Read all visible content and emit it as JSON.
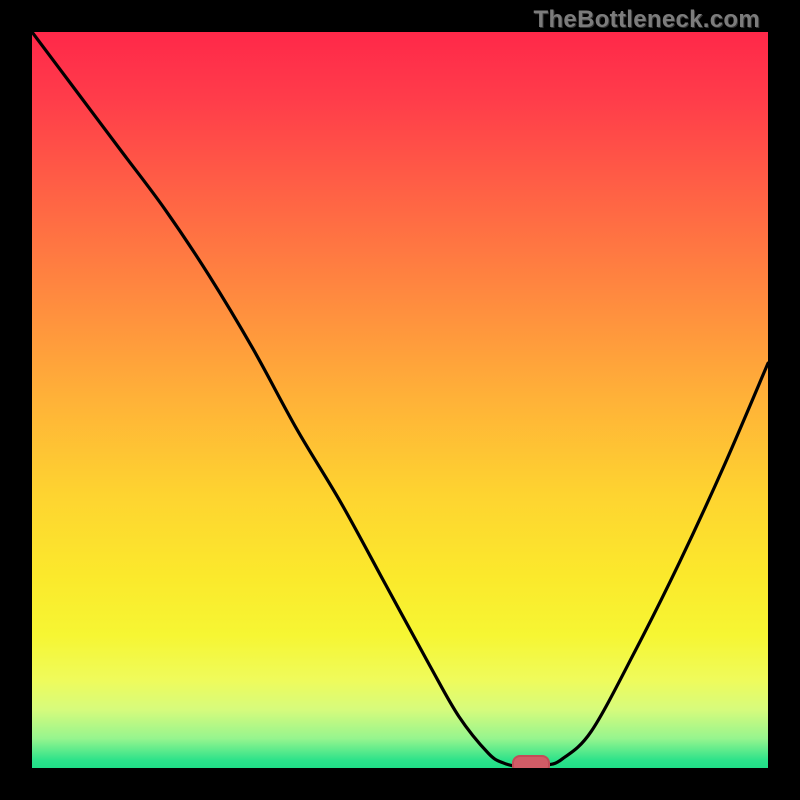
{
  "watermark": "TheBottleneck.com",
  "colors": {
    "gradient_top": "#FF2849",
    "gradient_mid": "#FED430",
    "gradient_bottom": "#20DE87",
    "curve": "#000000",
    "marker_fill": "#D15C66",
    "marker_border": "#C34C58",
    "frame": "#000000"
  },
  "chart_data": {
    "type": "line",
    "title": "",
    "xlabel": "",
    "ylabel": "",
    "xlim": [
      0,
      100
    ],
    "ylim": [
      0,
      100
    ],
    "note": "V-shaped bottleneck curve; y=100 at left top, dips to 0 near x≈66-70, rises to ~55 at x=100. Bright green band at bottom (optimal zone).",
    "series": [
      {
        "name": "bottleneck-curve",
        "x": [
          0,
          6,
          12,
          18,
          24,
          30,
          36,
          42,
          48,
          54,
          58,
          62,
          64,
          66,
          68,
          70,
          72,
          76,
          82,
          88,
          94,
          100
        ],
        "values": [
          100,
          92,
          84,
          76,
          67,
          57,
          46,
          36,
          25,
          14,
          7,
          2,
          0.7,
          0.2,
          0.2,
          0.4,
          1.2,
          5,
          16,
          28,
          41,
          55
        ]
      }
    ],
    "marker": {
      "x": 67.5,
      "y": 0.6,
      "label": "optimal-point"
    }
  }
}
